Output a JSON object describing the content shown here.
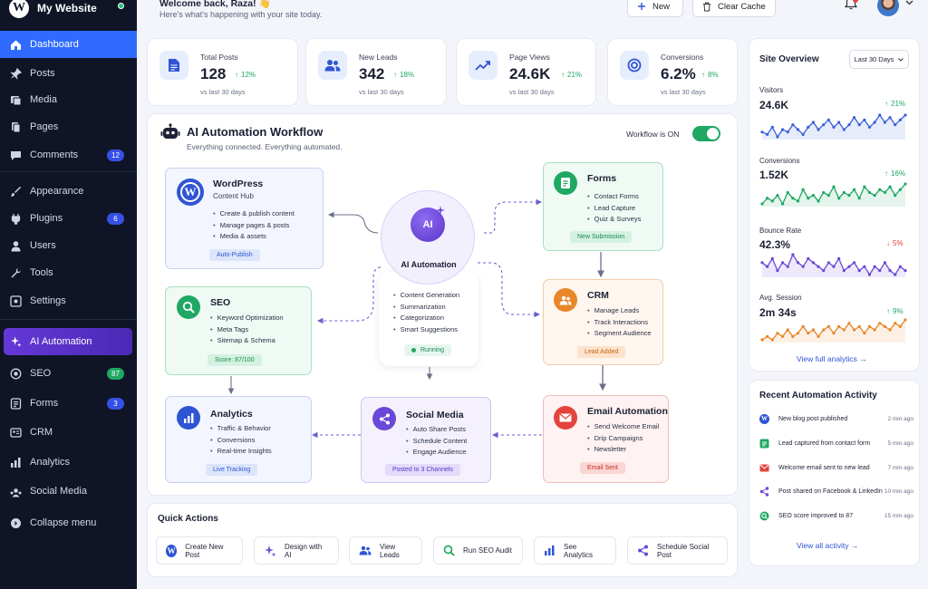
{
  "site": {
    "name": "My Website"
  },
  "sidebar": {
    "items": [
      {
        "label": "Dashboard"
      },
      {
        "label": "Posts"
      },
      {
        "label": "Media"
      },
      {
        "label": "Pages"
      },
      {
        "label": "Comments",
        "badge": "12"
      },
      {
        "label": "Appearance"
      },
      {
        "label": "Plugins",
        "badge": "6"
      },
      {
        "label": "Users"
      },
      {
        "label": "Tools"
      },
      {
        "label": "Settings"
      },
      {
        "label": "AI Automation"
      },
      {
        "label": "SEO",
        "badge": "87"
      },
      {
        "label": "Forms",
        "badge": "3"
      },
      {
        "label": "CRM"
      },
      {
        "label": "Analytics"
      },
      {
        "label": "Social Media"
      },
      {
        "label": "Collapse menu"
      }
    ]
  },
  "header": {
    "greeting": "Welcome back, Raza! 👋",
    "subtitle": "Here's what's happening with your site today.",
    "new_label": "New",
    "clear_cache_label": "Clear Cache"
  },
  "stats": [
    {
      "label": "Total Posts",
      "value": "128",
      "delta": "12%",
      "sub": "vs last 30 days"
    },
    {
      "label": "New Leads",
      "value": "342",
      "delta": "18%",
      "sub": "vs last 30 days"
    },
    {
      "label": "Page Views",
      "value": "24.6K",
      "delta": "21%",
      "sub": "vs last 30 days"
    },
    {
      "label": "Conversions",
      "value": "6.2%",
      "delta": "8%",
      "sub": "vs last 30 days"
    }
  ],
  "workflow": {
    "title": "AI Automation Workflow",
    "subtitle": "Everything connected. Everything automated.",
    "status_label": "Workflow is ON",
    "hub": {
      "icon_text": "AI",
      "title": "AI Automation",
      "items": [
        "Content Generation",
        "Summarization",
        "Categorization",
        "Smart Suggestions"
      ],
      "status": "Running"
    },
    "nodes": {
      "wordpress": {
        "title": "WordPress",
        "subtitle": "Content Hub",
        "items": [
          "Create & publish content",
          "Manage pages & posts",
          "Media & assets"
        ],
        "tag": "Auto-Publish"
      },
      "seo": {
        "title": "SEO",
        "items": [
          "Keyword Optimization",
          "Meta Tags",
          "Sitemap & Schema"
        ],
        "tag": "Score: 87/100"
      },
      "analytics": {
        "title": "Analytics",
        "items": [
          "Traffic & Behavior",
          "Conversions",
          "Real-time Insights"
        ],
        "tag": "Live Tracking"
      },
      "social": {
        "title": "Social Media",
        "items": [
          "Auto Share Posts",
          "Schedule Content",
          "Engage Audience"
        ],
        "tag": "Posted to 3 Channels"
      },
      "forms": {
        "title": "Forms",
        "items": [
          "Contact Forms",
          "Lead Capture",
          "Quiz & Surveys"
        ],
        "tag": "New Submission"
      },
      "crm": {
        "title": "CRM",
        "items": [
          "Manage Leads",
          "Track Interactions",
          "Segment Audience"
        ],
        "tag": "Lead Added"
      },
      "email": {
        "title": "Email Automation",
        "items": [
          "Send Welcome Email",
          "Drip Campaigns",
          "Newsletter"
        ],
        "tag": "Email Sent"
      }
    }
  },
  "quick_actions": {
    "title": "Quick Actions",
    "items": [
      {
        "label": "Create New Post"
      },
      {
        "label": "Design with AI"
      },
      {
        "label": "View Leads"
      },
      {
        "label": "Run SEO Audit"
      },
      {
        "label": "See Analytics"
      },
      {
        "label": "Schedule Social Post"
      }
    ]
  },
  "overview": {
    "title": "Site Overview",
    "range": "Last 30 Days",
    "metrics": [
      {
        "label": "Visitors",
        "value": "24.6K",
        "delta": "21%",
        "direction": "up",
        "color": "#3a5fd9",
        "series": [
          5,
          4,
          7,
          3,
          6,
          5,
          8,
          6,
          4,
          7,
          9,
          6,
          8,
          10,
          7,
          9,
          6,
          8,
          11,
          8,
          10,
          7,
          9,
          12,
          9,
          11,
          8,
          10,
          12
        ]
      },
      {
        "label": "Conversions",
        "value": "1.52K",
        "delta": "16%",
        "direction": "up",
        "color": "#1ea862",
        "series": [
          3,
          5,
          4,
          6,
          3,
          7,
          5,
          4,
          8,
          5,
          6,
          4,
          7,
          6,
          9,
          5,
          7,
          6,
          8,
          5,
          9,
          7,
          6,
          8,
          7,
          9,
          6,
          8,
          10
        ]
      },
      {
        "label": "Bounce Rate",
        "value": "42.3%",
        "delta": "5%",
        "direction": "down",
        "color": "#6a48d7",
        "series": [
          8,
          7,
          9,
          6,
          8,
          7,
          10,
          8,
          7,
          9,
          8,
          7,
          6,
          8,
          7,
          9,
          6,
          7,
          8,
          6,
          7,
          5,
          7,
          6,
          8,
          6,
          5,
          7,
          6
        ]
      },
      {
        "label": "Avg. Session",
        "value": "2m 34s",
        "delta": "9%",
        "direction": "up",
        "color": "#e8862a",
        "series": [
          4,
          5,
          4,
          6,
          5,
          7,
          5,
          6,
          8,
          6,
          7,
          5,
          7,
          8,
          6,
          8,
          7,
          9,
          7,
          8,
          6,
          8,
          7,
          9,
          8,
          7,
          9,
          8,
          10
        ]
      }
    ],
    "link": "View full analytics"
  },
  "activity": {
    "title": "Recent Automation Activity",
    "items": [
      {
        "text": "New blog post published",
        "time": "2 min ago"
      },
      {
        "text": "Lead captured from contact form",
        "time": "5 min ago"
      },
      {
        "text": "Welcome email sent to new lead",
        "time": "7 min ago"
      },
      {
        "text": "Post shared on Facebook & LinkedIn",
        "time": "10 min ago"
      },
      {
        "text": "SEO score improved to 87",
        "time": "15 min ago"
      }
    ],
    "link": "View all activity"
  }
}
